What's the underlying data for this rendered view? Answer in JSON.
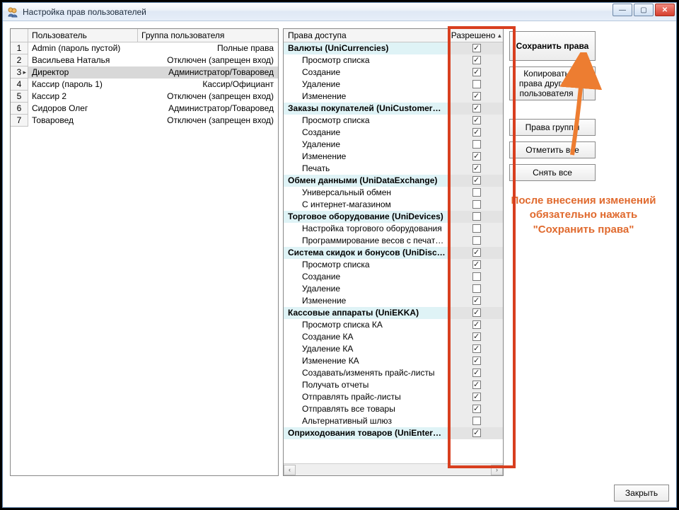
{
  "window": {
    "title": "Настройка прав пользователей"
  },
  "usersTable": {
    "headers": {
      "user": "Пользователь",
      "group": "Группа пользователя"
    },
    "rows": [
      {
        "n": "1",
        "user": "Admin (пароль пустой)",
        "group": "Полные права",
        "selected": false
      },
      {
        "n": "2",
        "user": "Васильева Наталья",
        "group": "Отключен (запрещен вход)",
        "selected": false
      },
      {
        "n": "3",
        "user": "Директор",
        "group": "Администратор/Товаровед",
        "selected": true
      },
      {
        "n": "4",
        "user": "Кассир (пароль 1)",
        "group": "Кассир/Официант",
        "selected": false
      },
      {
        "n": "5",
        "user": "Кассир 2",
        "group": "Отключен (запрещен вход)",
        "selected": false
      },
      {
        "n": "6",
        "user": "Сидоров Олег",
        "group": "Администратор/Товаровед",
        "selected": false
      },
      {
        "n": "7",
        "user": "Товаровед",
        "group": "Отключен (запрещен вход)",
        "selected": false
      }
    ]
  },
  "permsTable": {
    "headers": {
      "perm": "Права доступа",
      "allow": "Разрешено"
    },
    "rows": [
      {
        "label": "Валюты (UniCurrencies)",
        "group": true,
        "checked": true
      },
      {
        "label": "Просмотр списка",
        "group": false,
        "checked": true
      },
      {
        "label": "Создание",
        "group": false,
        "checked": true
      },
      {
        "label": "Удаление",
        "group": false,
        "checked": false
      },
      {
        "label": "Изменение",
        "group": false,
        "checked": true
      },
      {
        "label": "Заказы покупателей (UniCustomerO…",
        "group": true,
        "checked": true
      },
      {
        "label": "Просмотр списка",
        "group": false,
        "checked": true
      },
      {
        "label": "Создание",
        "group": false,
        "checked": true
      },
      {
        "label": "Удаление",
        "group": false,
        "checked": false
      },
      {
        "label": "Изменение",
        "group": false,
        "checked": true
      },
      {
        "label": "Печать",
        "group": false,
        "checked": true
      },
      {
        "label": "Обмен данными (UniDataExchange)",
        "group": true,
        "checked": true
      },
      {
        "label": "Универсальный обмен",
        "group": false,
        "checked": false
      },
      {
        "label": "С интернет-магазином",
        "group": false,
        "checked": false
      },
      {
        "label": "Торговое оборудование (UniDevices)",
        "group": true,
        "checked": false
      },
      {
        "label": "Настройка торгового оборудования",
        "group": false,
        "checked": false
      },
      {
        "label": "Программирование весов с печатью эт…",
        "group": false,
        "checked": false
      },
      {
        "label": "Система скидок и бонусов (UniDisco…",
        "group": true,
        "checked": true
      },
      {
        "label": "Просмотр списка",
        "group": false,
        "checked": true
      },
      {
        "label": "Создание",
        "group": false,
        "checked": false
      },
      {
        "label": "Удаление",
        "group": false,
        "checked": false
      },
      {
        "label": "Изменение",
        "group": false,
        "checked": true
      },
      {
        "label": "Кассовые аппараты (UniEKKA)",
        "group": true,
        "checked": true
      },
      {
        "label": "Просмотр списка КА",
        "group": false,
        "checked": true
      },
      {
        "label": "Создание КА",
        "group": false,
        "checked": true
      },
      {
        "label": "Удаление КА",
        "group": false,
        "checked": true
      },
      {
        "label": "Изменение КА",
        "group": false,
        "checked": true
      },
      {
        "label": "Создавать/изменять прайс-листы",
        "group": false,
        "checked": true
      },
      {
        "label": "Получать отчеты",
        "group": false,
        "checked": true
      },
      {
        "label": "Отправлять прайс-листы",
        "group": false,
        "checked": true
      },
      {
        "label": "Отправлять все товары",
        "group": false,
        "checked": true
      },
      {
        "label": "Альтернативный шлюз",
        "group": false,
        "checked": false
      },
      {
        "label": "Оприходования товаров (UniEnterG…",
        "group": true,
        "checked": true
      }
    ]
  },
  "buttons": {
    "save": "Сохранить права",
    "copy": "Копировать права другого пользователя",
    "groupRights": "Права группы",
    "checkAll": "Отметить все",
    "uncheckAll": "Снять  все",
    "close": "Закрыть"
  },
  "annotation": {
    "text": "После внесения изменений обязательно нажать \"Сохранить права\""
  }
}
